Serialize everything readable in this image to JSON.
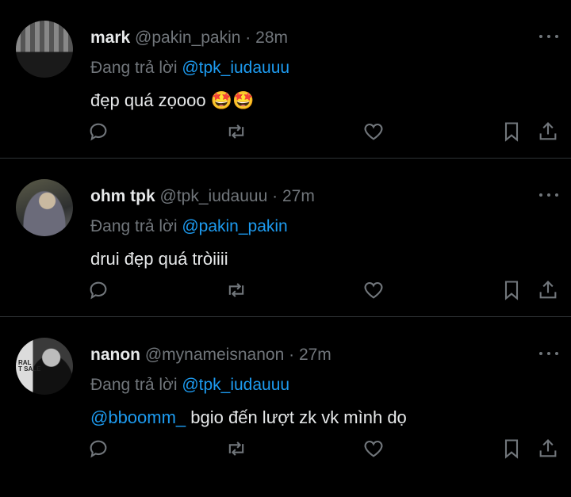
{
  "tweets": [
    {
      "name": "mark",
      "handle": "@pakin_pakin",
      "dot": "·",
      "time": "28m",
      "reply_prefix": "Đang trả lời",
      "reply_to": "@tpk_iudauuu",
      "text": "đẹp quá zọooo 🤩🤩",
      "mention": ""
    },
    {
      "name": "ohm tpk",
      "handle": "@tpk_iudauuu",
      "dot": "·",
      "time": "27m",
      "reply_prefix": "Đang trả lời",
      "reply_to": "@pakin_pakin",
      "text": "drui đẹp quá tròiiii",
      "mention": ""
    },
    {
      "name": "nanon",
      "handle": "@mynameisnanon",
      "dot": "·",
      "time": "27m",
      "reply_prefix": "Đang trả lời",
      "reply_to": "@tpk_iudauuu",
      "mention": "@bboomm_",
      "text": " bgio đến lượt zk vk mình dọ",
      "avatar_text": "RAL\nT SALE"
    }
  ],
  "icons": {
    "reply": "reply-icon",
    "retweet": "retweet-icon",
    "like": "heart-icon",
    "bookmark": "bookmark-icon",
    "share": "share-icon",
    "more": "more-icon"
  },
  "colors": {
    "link": "#1d9bf0",
    "muted": "#71767b",
    "text": "#e7e9ea",
    "background": "#000000"
  }
}
